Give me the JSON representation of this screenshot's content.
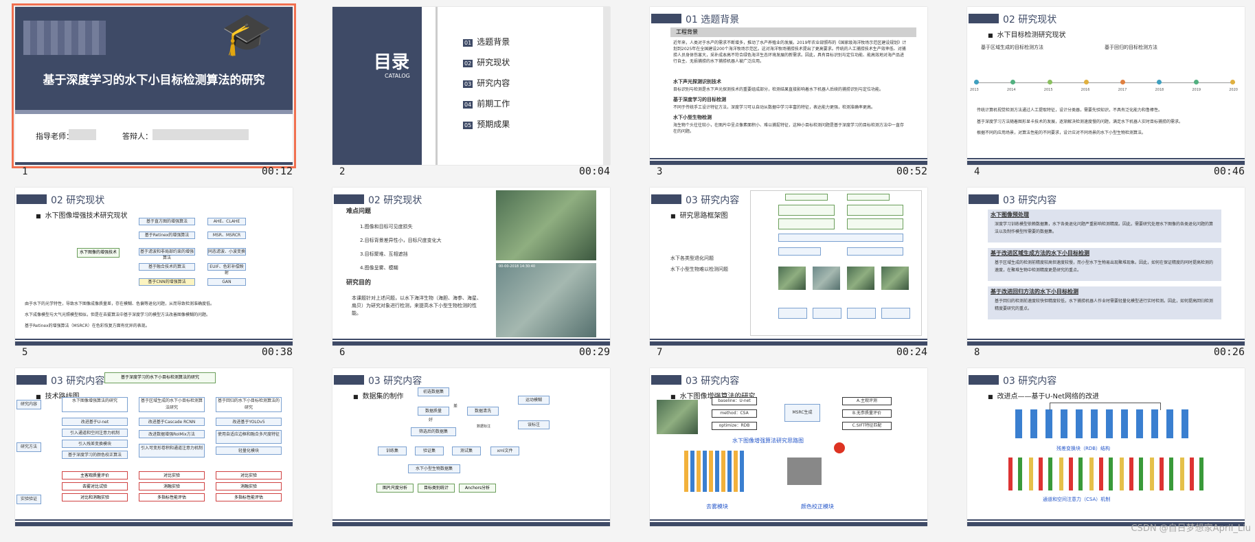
{
  "slides": [
    {
      "num": "1",
      "duration": "00:12",
      "title": "基于深度学习的水下小目标检测算法的研究",
      "advisor_label": "指导老师：",
      "student_label": "答辩人："
    },
    {
      "num": "2",
      "duration": "00:04",
      "title": "目录",
      "subtitle": "CATALOG",
      "items": [
        "选题背景",
        "研究现状",
        "研究内容",
        "前期工作",
        "预期成果"
      ],
      "item_nums": [
        "01",
        "02",
        "03",
        "04",
        "05"
      ]
    },
    {
      "num": "3",
      "duration": "00:52",
      "section": "01 选题背景",
      "box": "工程背景",
      "p1": "近年来，人类对于水产的需求不断增多，推动了水产养殖业的发展。2019年农业部颁布的《国家级海洋牧场示范区建设规划》计划到2025年在全国建设200个海洋牧场示范区。这对海洋牧场捕捞技术提出了更高要求。传统的人工捕捞技术生产效率低、对捕捞人员身体伤害大，采补成本高不符合绿色海洋生态环境发展的新需求。因此，具有目标识别与定位功能、能高效地对海产品进行自主、无损捕捞的水下捕捞机器人被广泛应用。",
      "h1": "水下声光探测识别技术",
      "p2": "目标识别与检测是水下声光探测技术的重要组成部分，检测结果直接影响着水下机器人后续的捕捞识别与定位功能。",
      "h2": "基于深度学习的目标检测",
      "p3": "不同于传统手工设计特征方法，深度学习可以自动从数据中学习丰富的特征，表达能力更强，检测准确率更高。",
      "h3": "水下小型生物检测",
      "p4": "海生物个头往往较小，在图片中呈点像素面积小、难以捕捉特征，这种小目标检测问题是基于深度学习的目标检测方法中一直存在的问题。"
    },
    {
      "num": "4",
      "duration": "00:46",
      "section": "02 研究现状",
      "sub": "水下目标检测研究现状",
      "t1": "基于区域生成的目标检测方法",
      "t2": "基于回归的目标检测方法",
      "years": [
        "2013",
        "2014",
        "2015",
        "2016",
        "2017",
        "2018",
        "2019",
        "2020"
      ],
      "b1": "传统计算机视觉检测方法通过人工提取特征，设计分类器，需要先验知识，不具有泛化能力和鲁棒性。",
      "b2": "基于深度学习方法随着图形显卡技术的发展，逐渐解决检测速度慢的问题，满足水下机器人实时目标捕捞的需求。",
      "b3": "根据不同的应用场景，对算法性能的不同要求，设计应对不同场景的水下小型生物检测算法。"
    },
    {
      "num": "5",
      "duration": "00:38",
      "section": "02 研究现状",
      "sub": "水下图像增强技术研究现状",
      "root": "水下图像的增强技术",
      "branches": [
        "基于直方图的增强算法",
        "基于Retinex的增强算法",
        "基于滤波和非局部约束的增强算法",
        "基于融合技术的算法",
        "基于CNN的增强算法"
      ],
      "leaves": [
        "AHE、CLAHE",
        "MSR、MSRCR",
        "同态滤波、小波变换",
        "EUIF、色彩补偿映射",
        "GAN"
      ],
      "b1": "由于水下的光学特性，导致水下图像成像质量差，存在模糊、色偏等退化问题，从而导致检测准确度低。",
      "b2": "水下成像模型与大气光照模型相似，但是在去雾算法中基于深度学习的模型方法改善图像模糊的问题。",
      "b3": "基于Retinex的增强算法（MSRCR）在色彩恢复方面有优异的表现。"
    },
    {
      "num": "6",
      "duration": "00:29",
      "section": "02 研究现状",
      "h1": "难点问题",
      "items": [
        "1.图像和目标可见度损失",
        "2.目标背景差异性小，目标尺度变化大",
        "3.目标聚堆、互相遮挡",
        "4.图像呈雾、模糊"
      ],
      "h2": "研究目的",
      "p": "本课题针对上述问题，以水下海洋生物（海胆、海参、海星、扇贝）为研究对象进行检测，来提高水下小型生物检测的性能。",
      "stamp": "00-00-2018 14:30:40"
    },
    {
      "num": "7",
      "duration": "00:24",
      "section": "03 研究内容",
      "sub": "研究思路框架图",
      "p1": "水下各类型退化问题",
      "p2": "水下小型生物难以检测问题"
    },
    {
      "num": "8",
      "duration": "00:26",
      "section": "03 研究内容",
      "h1": "水下图像预处理",
      "p1": "深度学习训练模型依赖数据集，水下各类退化问题严重影响检测精度。因此，需要研究处理水下图像的各类退化问题的算法以及制作模型所需要的数据集。",
      "h2": "基于改进区域生成方法的水下小目标检测",
      "p2": "基于区域生成的检测前精度较高但速度较慢，而小型水下生物易出现聚堆现象。因此，如何在保证精度的同时提高检测的速度，在聚堆生物中检测精度更是研究的重点。",
      "h3": "基于改进回归方法的水下小目标检测",
      "p3": "基于回归的检测前速度较快但精度较低，水下捕捞机器人作业时需要轻量化模型进行实时检测。因此，如何提高回归检测精度要研究的重点。"
    },
    {
      "num": "9",
      "duration": "",
      "section": "03 研究内容",
      "sub": "技术路线图",
      "top": "基于深度学习的水下小目标检测算法的研究",
      "cols": [
        "水下图像增强算法的研究",
        "基于区域生成的水下小目标检测算法研究",
        "基于回归的水下小目标检测算法的研究"
      ],
      "rows": [
        "研究内容",
        "研究方法",
        "实验验证"
      ],
      "m1": [
        "改进基于U-net",
        "引入通道和空间注意力机制",
        "引入残差变换模块",
        "基于深度学习的颜色校正算法"
      ],
      "m2": [
        "改进基于Cascade RCNN",
        "改进数据增强RoIMix方法",
        "引入可变形卷积和通道注意力机制"
      ],
      "m3": [
        "改进基于YOLOv5",
        "使用自适应边框和融合多尺度特征",
        "轻量化模块"
      ],
      "e1": [
        "主客观质量评价",
        "去雾对比试验",
        "对比和消融实验"
      ],
      "e2": [
        "对比实验",
        "消融实验",
        "多指标性能评估"
      ],
      "e3": [
        "对比实验",
        "消融实验",
        "多指标性能评估"
      ]
    },
    {
      "num": "10",
      "duration": "",
      "section": "03 研究内容",
      "sub": "数据集的制作",
      "nodes": [
        "初选数据集",
        "数据质量",
        "数据清洗",
        "筛选后的数据集",
        "运动模糊",
        "误标注",
        "数据标注",
        "训练集",
        "验证集",
        "测试集",
        "xml文件",
        "水下小型生物数据集",
        "图片尺度分析",
        "目标类别统计",
        "Anchors分析"
      ],
      "n_bad": "差",
      "n_good": "好"
    },
    {
      "num": "11",
      "duration": "",
      "section": "03 研究内容",
      "sub": "水下图像增强算法的研究",
      "lab1": "baseline：U-net",
      "lab2": "method：CSA",
      "lab3": "optimize：RDB",
      "mid": "MSRC生成",
      "r1": "A.主观评测",
      "r2": "B.无参质量评价",
      "r3": "C.SIFT特征匹配",
      "cap1": "水下图像增强算法研究思路图",
      "cap2": "去雾模块",
      "cap3": "颜色校正模块"
    },
    {
      "num": "12",
      "duration": "",
      "section": "03 研究内容",
      "sub": "改进点——基于U-Net网络的改进",
      "cap1": "残差变换块（RDB）结构",
      "cap2": "通道和空间注意力（CSA）机制",
      "watermark": "CSDN @自日梦想家April_Liu"
    }
  ]
}
